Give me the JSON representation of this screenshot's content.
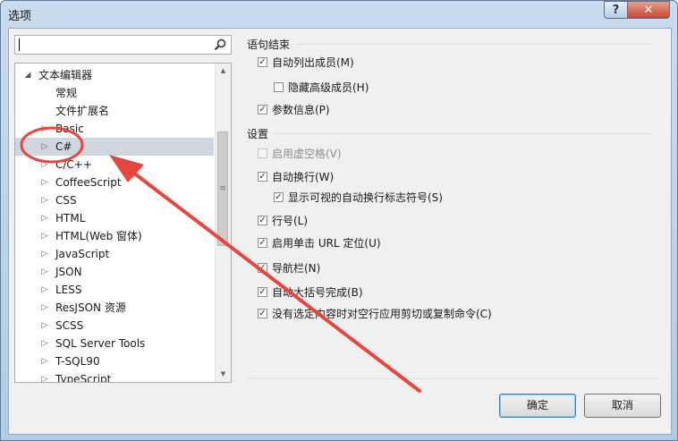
{
  "window": {
    "title": "选项",
    "help_label": "?",
    "close_label": "✕"
  },
  "search": {
    "value": "",
    "icon": "magnifier-icon"
  },
  "tree": {
    "root": "文本编辑器",
    "items": [
      {
        "label": "常规"
      },
      {
        "label": "文件扩展名"
      },
      {
        "label": "Basic"
      },
      {
        "label": "C#",
        "selected": true
      },
      {
        "label": "C/C++"
      },
      {
        "label": "CoffeeScript"
      },
      {
        "label": "CSS"
      },
      {
        "label": "HTML"
      },
      {
        "label": "HTML(Web 窗体)"
      },
      {
        "label": "JavaScript"
      },
      {
        "label": "JSON"
      },
      {
        "label": "LESS"
      },
      {
        "label": "ResJSON 资源"
      },
      {
        "label": "SCSS"
      },
      {
        "label": "SQL Server Tools"
      },
      {
        "label": "T-SQL90"
      },
      {
        "label": "TypeScript"
      }
    ]
  },
  "statement_completion": {
    "heading": "语句结束",
    "auto_list_members": {
      "label": "自动列出成员(M)",
      "checked": true
    },
    "hide_advanced_members": {
      "label": "隐藏高级成员(H)",
      "checked": false
    },
    "parameter_info": {
      "label": "参数信息(P)",
      "checked": true
    }
  },
  "settings": {
    "heading": "设置",
    "virtual_space": {
      "label": "启用虚空格(V)",
      "checked": false,
      "enabled": false
    },
    "word_wrap": {
      "label": "自动换行(W)",
      "checked": true
    },
    "show_wrap_glyphs": {
      "label": "显示可视的自动换行标志符号(S)",
      "checked": true
    },
    "line_numbers": {
      "label": "行号(L)",
      "checked": true
    },
    "single_click_url": {
      "label": "启用单击 URL 定位(U)",
      "checked": true
    },
    "navigation_bar": {
      "label": "导航栏(N)",
      "checked": true
    },
    "auto_brace": {
      "label": "自动大括号完成(B)",
      "checked": true
    },
    "cut_copy_blank": {
      "label": "没有选定内容时对空行应用剪切或复制命令(C)",
      "checked": true
    }
  },
  "buttons": {
    "ok": "确定",
    "cancel": "取消"
  },
  "colors": {
    "annotation_red": "#e8453c",
    "selection": "#cfd6e0",
    "title_gradient_top": "#c9dcee"
  }
}
